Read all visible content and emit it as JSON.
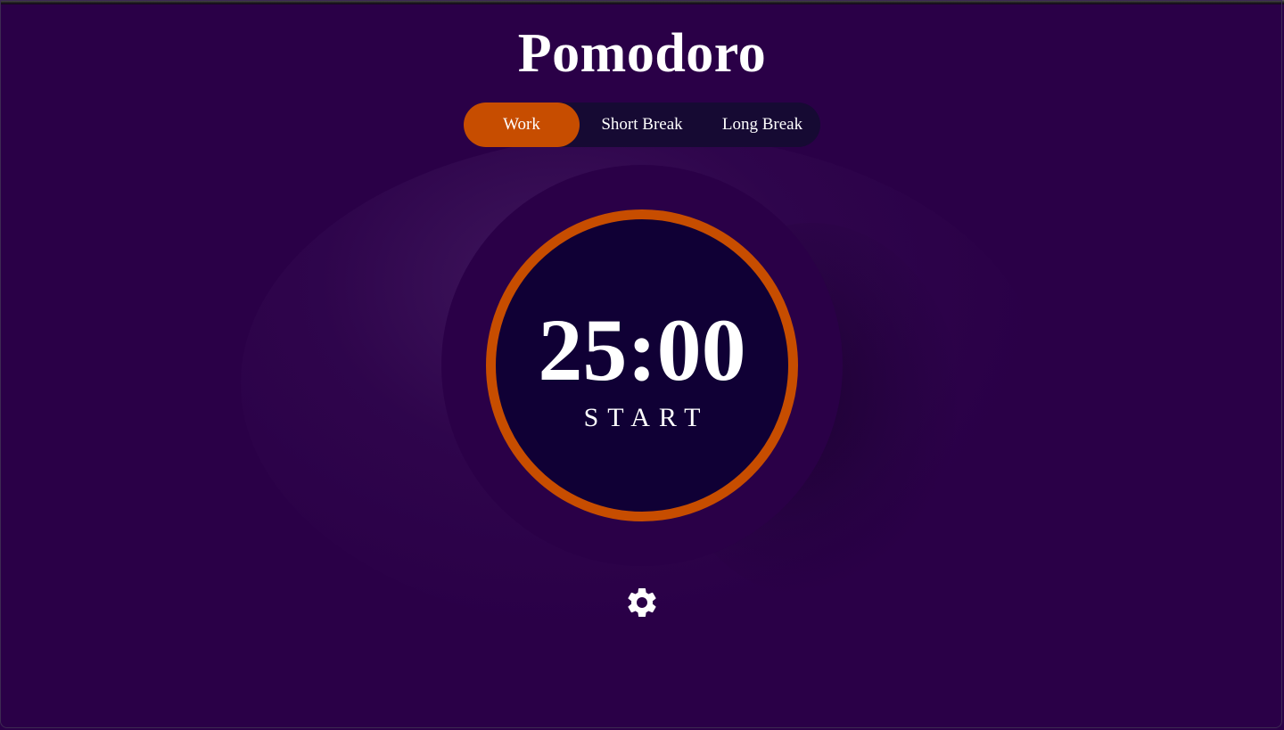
{
  "app": {
    "title": "Pomodoro"
  },
  "modes": {
    "items": [
      {
        "label": "Work",
        "active": true
      },
      {
        "label": "Short Break",
        "active": false
      },
      {
        "label": "Long Break",
        "active": false
      }
    ]
  },
  "timer": {
    "time": "25:00",
    "action_label": "START",
    "progress": 1.0
  },
  "settings": {
    "icon": "gear-icon"
  },
  "colors": {
    "background": "#2a0047",
    "accent": "#c74d00",
    "timer_face": "#100035",
    "tab_bar": "#160a33",
    "text": "#ffffff"
  }
}
